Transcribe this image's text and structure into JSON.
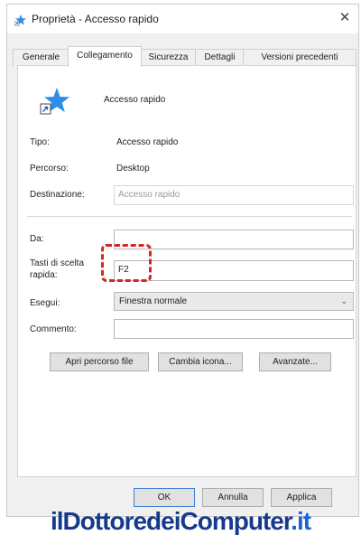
{
  "window": {
    "title": "Proprietà - Accesso rapido",
    "close_icon": "close-icon"
  },
  "tabs": [
    {
      "label": "Generale",
      "active": false
    },
    {
      "label": "Collegamento",
      "active": true
    },
    {
      "label": "Sicurezza",
      "active": false
    },
    {
      "label": "Dettagli",
      "active": false
    },
    {
      "label": "Versioni precedenti",
      "active": false
    }
  ],
  "shortcut": {
    "name": "Accesso rapido",
    "icon": "star-shortcut-icon",
    "fields": {
      "tipo": {
        "label": "Tipo:",
        "value": "Accesso rapido"
      },
      "percorso": {
        "label": "Percorso:",
        "value": "Desktop"
      },
      "destinazione": {
        "label": "Destinazione:",
        "value": "Accesso rapido"
      },
      "da": {
        "label": "Da:",
        "value": ""
      },
      "tasti": {
        "label_line1": "Tasti di scelta",
        "label_line2": "rapida:",
        "value": "F2"
      },
      "esegui": {
        "label": "Esegui:",
        "value": "Finestra normale"
      },
      "commento": {
        "label": "Commento:",
        "value": ""
      }
    },
    "buttons": {
      "apri_percorso": "Apri percorso file",
      "cambia_icona": "Cambia icona...",
      "avanzate": "Avanzate..."
    }
  },
  "footer": {
    "ok": "OK",
    "annulla": "Annulla",
    "applica": "Applica"
  },
  "watermark": {
    "name": "ilDottoredeiComputer",
    "tld": ".it"
  },
  "colors": {
    "highlight": "#d7261e",
    "accent": "#3c7fd1",
    "watermark": "#163a8c"
  }
}
